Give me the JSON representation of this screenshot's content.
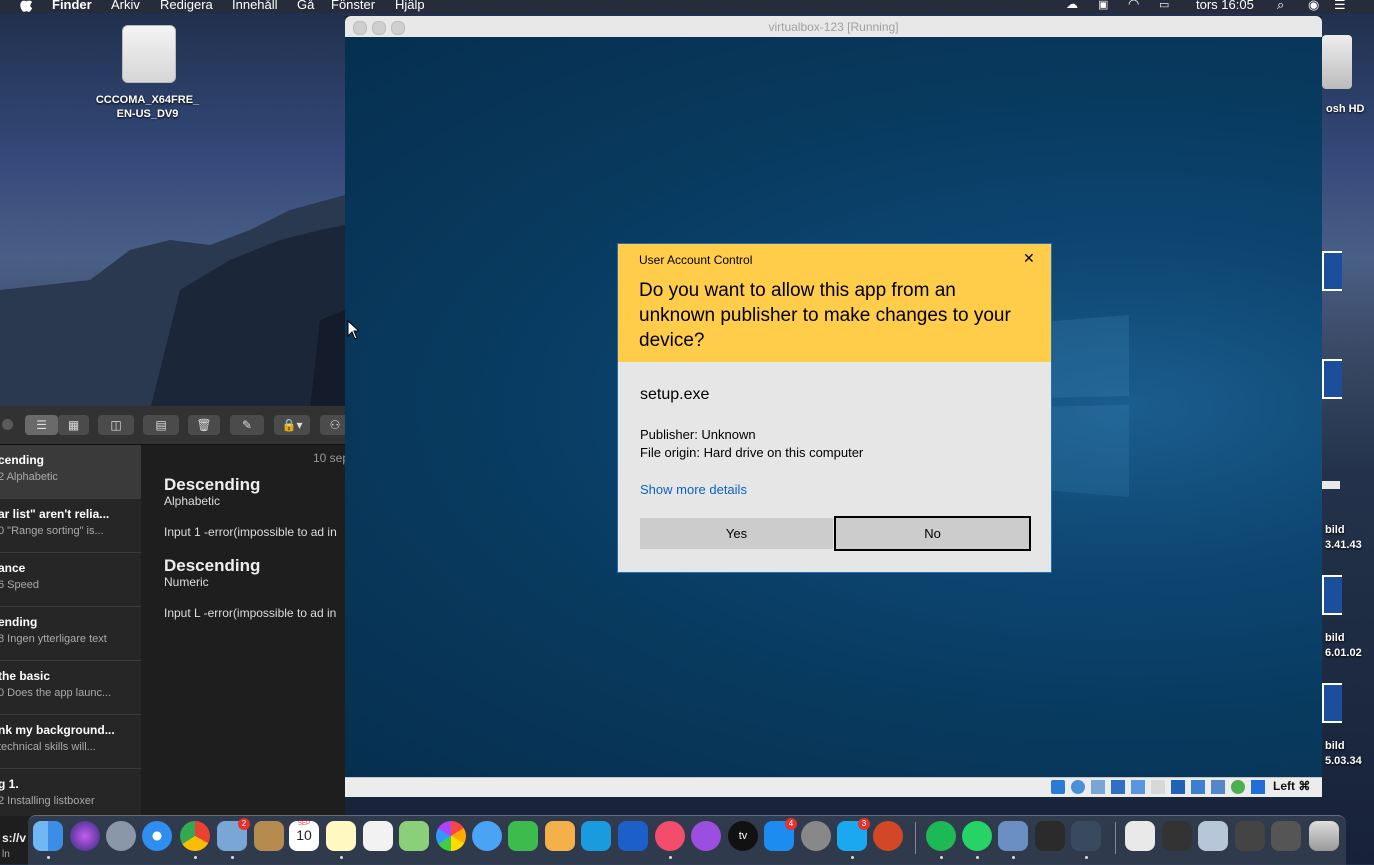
{
  "menubar": {
    "apple": "",
    "app": "Finder",
    "items": [
      "Arkiv",
      "Redigera",
      "Innehåll",
      "Gå",
      "Fönster",
      "Hjälp"
    ],
    "clock": "tors 16:05"
  },
  "desktop": {
    "drive_label_1": "CCCOMA_X64FRE_",
    "drive_label_2": "EN-US_DV9",
    "right_hd": "osh HD",
    "right_items": [
      {
        "line1": "bild",
        "line2": "3.41.43"
      },
      {
        "line1": "bild",
        "line2": "6.01.02"
      },
      {
        "line1": "bild",
        "line2": "5.03.34"
      }
    ]
  },
  "notes": {
    "list": [
      {
        "title": "cending",
        "sub": "2  Alphabetic"
      },
      {
        "title": "ar list\" aren't relia...",
        "sub": "0  \"Range sorting\" is..."
      },
      {
        "title": "ance",
        "sub": "6  Speed"
      },
      {
        "title": "ending",
        "sub": "8  Ingen ytterligare text"
      },
      {
        "title": " the basic",
        "sub": "0  Does the app launc..."
      },
      {
        "title": "nk my background...",
        "sub": "   technical skills will..."
      },
      {
        "title": "g 1.",
        "sub": "2  Installing listboxer"
      }
    ],
    "date": "10 sep",
    "body": {
      "h1": "Descending",
      "h1_sub": "Alphabetic",
      "p1": "Input 1 -error(impossible to ad in",
      "h2": "Descending",
      "h2_sub": "Numeric",
      "p2": "Input L -error(impossible to ad in"
    },
    "left_bottom": "s://v",
    "left_bottom2": "ln"
  },
  "vbox": {
    "title": "virtualbox-123 [Running]",
    "host_key": "Left ⌘"
  },
  "uac": {
    "header": "User Account Control",
    "question": "Do you want to allow this app from an unknown publisher to make changes to your device?",
    "app_name": "setup.exe",
    "publisher": "Publisher: Unknown",
    "origin": "File origin: Hard drive on this computer",
    "more": "Show more details",
    "yes": "Yes",
    "no": "No",
    "close": "✕"
  },
  "dock": {
    "calendar_month": "SEP",
    "calendar_day": "10",
    "badge_mail": "2",
    "badge_appstore": "4",
    "badge_skype": "3",
    "appletv": "tv"
  },
  "colors": {
    "uac_yellow": "#ffcd4a",
    "uac_link": "#0a62c4",
    "win_blue": "#0b456f"
  }
}
